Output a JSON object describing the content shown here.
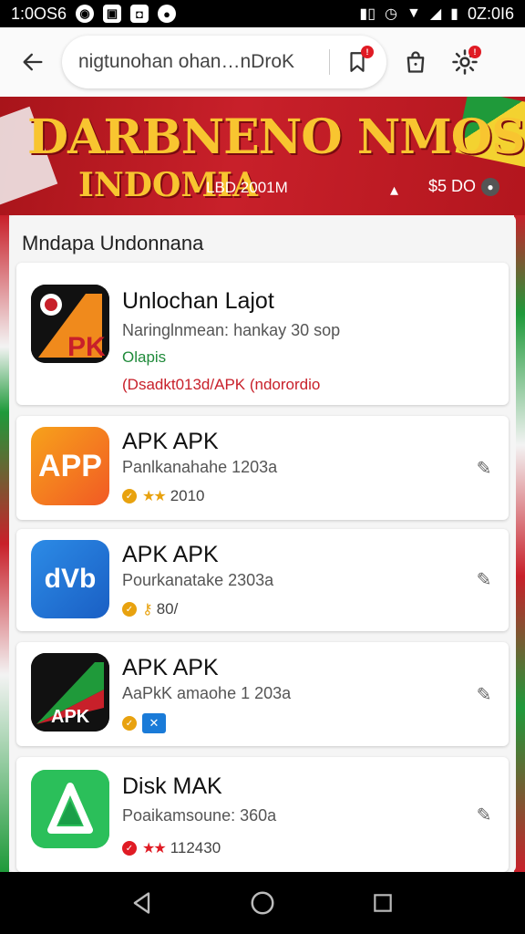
{
  "status_bar": {
    "time": "1:0OS6",
    "right_time": "0Z:0I6"
  },
  "search": {
    "text": "nigtunohan ohan…nDroK"
  },
  "banner": {
    "title": "DARBNENO NMOSA",
    "subtitle": "INDOMIA",
    "meta": "LBD 2001M",
    "price": "$5 DO"
  },
  "section": {
    "title": "Mndapa Undonnana"
  },
  "apps": [
    {
      "title": "Unlochan Lajot",
      "subtitle": "Naringlnmean: hankay 30 sop",
      "status": "Olapis",
      "note": "(Dsadkt013d/APK (ndorordio"
    },
    {
      "title": "APK APK",
      "subtitle": "Panlkanahahe 1203a",
      "rating": "2010",
      "icon_label": "APP"
    },
    {
      "title": "APK APK",
      "subtitle": "Pourkanatake 2303a",
      "rating": "80/",
      "icon_label": "dVb"
    },
    {
      "title": "APK APK",
      "subtitle": "AaPkK amaohe 1 203a",
      "icon_label": "APK"
    },
    {
      "title": "Disk MAK",
      "subtitle": "Poaikamsoune: 360a",
      "rating": "112430"
    }
  ],
  "colors": {
    "banner_red": "#c8202a",
    "banner_gold": "#f8c530",
    "badge_red": "#e01b24",
    "flag_green": "#1f9a3a"
  }
}
